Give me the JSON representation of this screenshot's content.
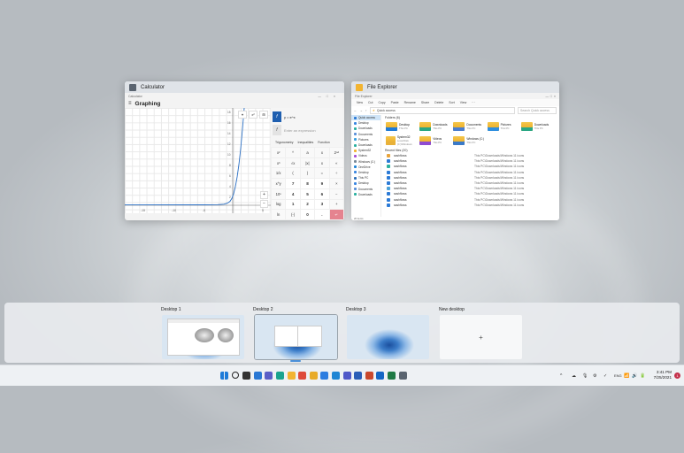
{
  "calculator": {
    "window_title": "Calculator",
    "app_label": "Calculator",
    "mode": "Graphing",
    "menu_icon": "hamburger-icon",
    "caption_controls": [
      "—",
      "□",
      "×"
    ],
    "functions": [
      {
        "badge": "f",
        "text": "y = e^x"
      },
      {
        "badge": "f",
        "text": "Enter an expression",
        "placeholder": true
      }
    ],
    "graph_tools": [
      "⌖",
      "x²",
      "⊞"
    ],
    "zoom": [
      "+",
      "−"
    ],
    "x_ticks": [
      "-15",
      "-10",
      "-5",
      "5"
    ],
    "y_ticks": [
      "18",
      "16",
      "14",
      "12",
      "10",
      "8",
      "6",
      "4",
      "2"
    ],
    "keypad_tabs": [
      "Trigonometry",
      "Inequalities",
      "Function"
    ],
    "keys": [
      "x²",
      "^",
      "a",
      "x",
      "2ⁿᵈ",
      "x³",
      "√x",
      "|x|",
      "x",
      "«",
      "1/x",
      "(",
      ")",
      "=",
      "÷",
      "x^y",
      "7",
      "8",
      "9",
      "×",
      "10ˣ",
      "4",
      "5",
      "6",
      "−",
      "log",
      "1",
      "2",
      "3",
      "+",
      "ln",
      "(-)",
      "0",
      ".",
      "↵"
    ]
  },
  "explorer": {
    "window_title": "File Explorer",
    "tab_label": "File Explorer",
    "ribbon": [
      "New",
      "Cut",
      "Copy",
      "Paste",
      "Rename",
      "Share",
      "Delete",
      "Sort",
      "View",
      "···"
    ],
    "address": "Quick access",
    "search_placeholder": "Search Quick access",
    "nav_items": [
      "Quick access",
      "Desktop",
      "Downloads",
      "Documents",
      "Pictures",
      "Downloads",
      "System32",
      "Videos",
      "Windows (C:)",
      "OneDrive",
      "Desktop",
      "This PC",
      "Desktop",
      "Documents",
      "Downloads"
    ],
    "quick_access_title": "Folders (6)",
    "quick_access": [
      {
        "name": "Desktop",
        "sub": "This PC"
      },
      {
        "name": "Downloads",
        "sub": "This PC"
      },
      {
        "name": "Documents",
        "sub": "This PC"
      },
      {
        "name": "Pictures",
        "sub": "This PC"
      },
      {
        "name": "Downloads",
        "sub": "This PC"
      },
      {
        "name": "System32",
        "sub": "Local Disk (C:)\\Windows"
      },
      {
        "name": "Videos",
        "sub": "This PC"
      },
      {
        "name": "Windows (C:)",
        "sub": "This PC"
      }
    ],
    "recent_title": "Recent files (20)",
    "recent_files": [
      "sashflows",
      "sashflows",
      "sashflows",
      "sashflows",
      "sashflows",
      "sashflows",
      "sashflows",
      "sashflows",
      "sashflows",
      "sashflows"
    ],
    "recent_location": "This PC\\Downloads\\Windows 11 icons",
    "status": "20 items"
  },
  "desktops": [
    {
      "label": "Desktop 1"
    },
    {
      "label": "Desktop 2",
      "current": true
    },
    {
      "label": "Desktop 3"
    },
    {
      "label": "New desktop",
      "plus": "+"
    }
  ],
  "taskbar": {
    "icons": [
      {
        "name": "start-icon",
        "color": "#1e7bd8"
      },
      {
        "name": "search-icon",
        "color": "#222222"
      },
      {
        "name": "task-view-icon",
        "color": "#333333"
      },
      {
        "name": "widgets-icon",
        "color": "#2a78d4"
      },
      {
        "name": "chat-icon",
        "color": "#5b5fc7"
      },
      {
        "name": "edge-icon",
        "color": "#1aa38f"
      },
      {
        "name": "file-explorer-icon",
        "color": "#f2b431"
      },
      {
        "name": "chrome-icon",
        "color": "#de4a3a"
      },
      {
        "name": "chrome-alt-icon",
        "color": "#e8ab29"
      },
      {
        "name": "todo-icon",
        "color": "#2d7de0"
      },
      {
        "name": "vscode-icon",
        "color": "#1f86d4"
      },
      {
        "name": "teams-icon",
        "color": "#5059c9"
      },
      {
        "name": "word-icon",
        "color": "#2b5eb7"
      },
      {
        "name": "powerpoint-icon",
        "color": "#c9482c"
      },
      {
        "name": "outlook-icon",
        "color": "#1466c4"
      },
      {
        "name": "excel-icon",
        "color": "#1f7a45"
      },
      {
        "name": "calculator-icon",
        "color": "#5a6470"
      }
    ],
    "tray": [
      "^",
      "☁",
      "🎙",
      "⚙",
      "✓",
      "ENG",
      "📶",
      "🔊",
      "🔋"
    ],
    "time": "3:41 PM",
    "date": "7/25/2021",
    "notifications": "1"
  }
}
